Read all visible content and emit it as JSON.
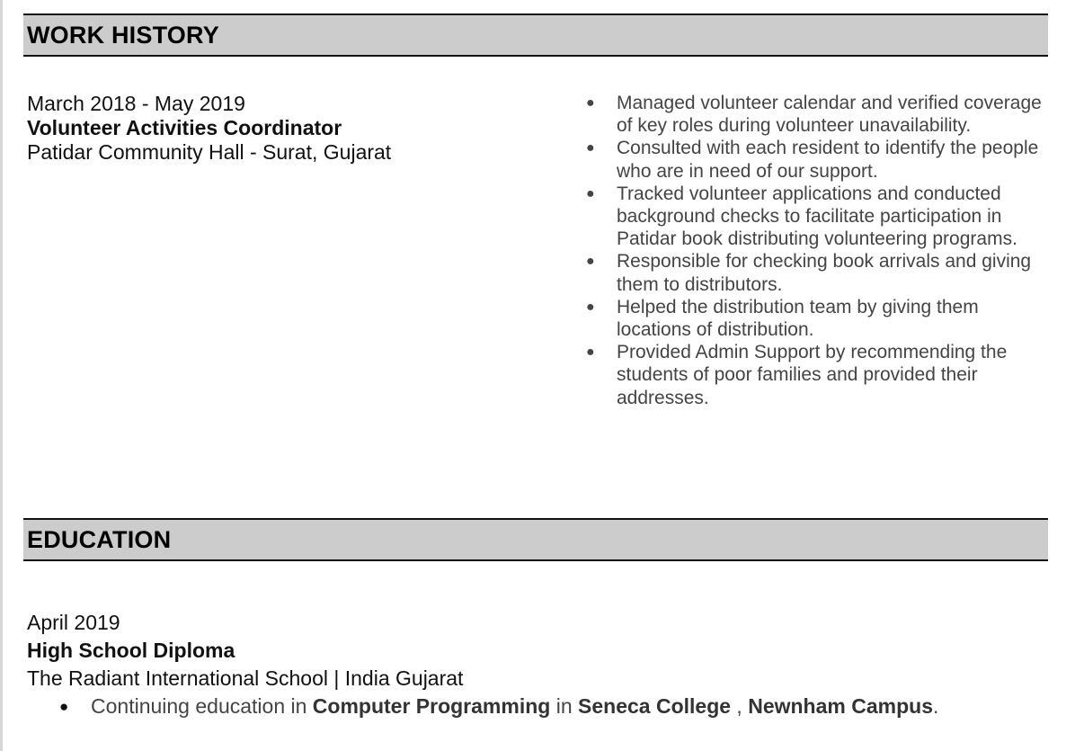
{
  "work_history": {
    "heading": "WORK HISTORY",
    "date": "March 2018 - May 2019",
    "title": "Volunteer Activities Coordinator",
    "employer": "Patidar Community Hall - Surat, Gujarat",
    "duties": [
      "Managed volunteer calendar and verified coverage of key roles during volunteer unavailability.",
      "Consulted with each resident to identify the people who are in need of our support.",
      "Tracked volunteer applications and conducted background checks to facilitate participation in Patidar book distributing volunteering programs.",
      "Responsible for checking book arrivals and giving them to distributors.",
      "Helped the distribution team by giving them locations of distribution.",
      "Provided Admin Support by recommending the students of poor families and provided their addresses."
    ]
  },
  "education": {
    "heading": "EDUCATION",
    "date": "April 2019",
    "degree": "High School Diploma",
    "school": "The Radiant International School | India Gujarat",
    "note": {
      "prefix": "Continuing education in ",
      "program": "Computer Programming",
      "connector": " in ",
      "college": "Seneca College",
      "separator": " , ",
      "campus": "Newnham Campus",
      "suffix": "."
    }
  }
}
